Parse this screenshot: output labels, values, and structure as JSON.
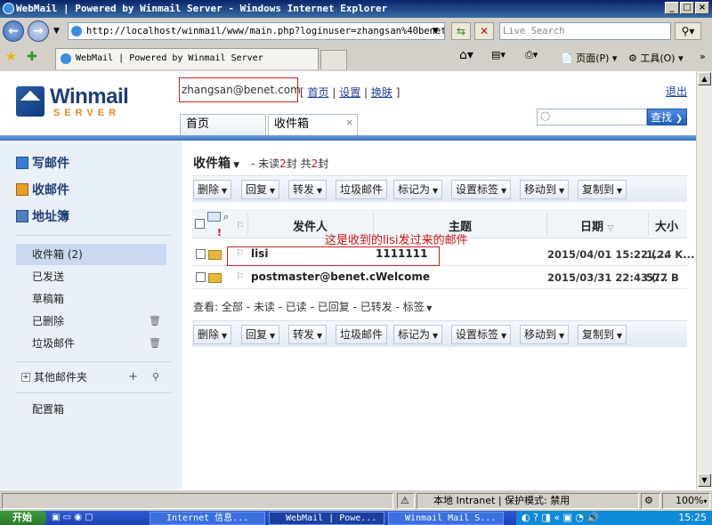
{
  "window": {
    "title": "WebMail | Powered by Winmail Server - Windows Internet Explorer"
  },
  "browser": {
    "url": "http://localhost/winmail/www/main.php?loginuser=zhangsan%40benet",
    "search_placeholder": "Live Search",
    "tab_label": "WebMail | Powered by Winmail Server",
    "page_menu": "页面(P)",
    "tools_menu": "工具(O)"
  },
  "header": {
    "logo_main": "Winmail",
    "logo_sub": "SERVER",
    "user": "zhangsan@benet.com",
    "links": {
      "home": "首页",
      "settings": "设置",
      "skin": "换肤"
    },
    "logout": "退出",
    "search_button": "查找",
    "tabs": [
      {
        "label": "首页"
      },
      {
        "label": "收件箱"
      }
    ]
  },
  "sidebar": {
    "compose": "写邮件",
    "receive": "收邮件",
    "contacts": "地址簿",
    "folders": [
      {
        "label": "收件箱 (2)"
      },
      {
        "label": "已发送"
      },
      {
        "label": "草稿箱"
      },
      {
        "label": "已删除"
      },
      {
        "label": "垃圾邮件"
      }
    ],
    "other_folders": "其他邮件夹",
    "config": "配置箱"
  },
  "main": {
    "folder_title": "收件箱",
    "unread_prefix": "- 未读",
    "unread_count": "2",
    "unread_unit": "封",
    "total_prefix": "共",
    "total_count": "2",
    "total_unit": "封",
    "toolbar": [
      "删除",
      "回复",
      "转发",
      "垃圾邮件",
      "标记为",
      "设置标签",
      "移动到",
      "复制到"
    ],
    "columns": {
      "sender": "发件人",
      "subject": "主题",
      "date": "日期",
      "size": "大小"
    },
    "messages": [
      {
        "sender": "lisi",
        "subject": "1111111",
        "date": "2015/04/01 15:22 (...",
        "size": "1.24 K..."
      },
      {
        "sender": "postmaster@benet.co...",
        "subject": "Welcome",
        "date": "2015/03/31 22:43 (...",
        "size": "577 B"
      }
    ],
    "annotation": "这是收到的lisi发过来的邮件",
    "view_filter": "查看: 全部 - 未读 - 已读 - 已回复 - 已转发 - 标签"
  },
  "statusbar": {
    "zone": "本地 Intranet | 保护模式: 禁用",
    "zoom": "100%"
  },
  "taskbar": {
    "start": "开始",
    "tasks": [
      "Internet 信息...",
      "WebMail | Powe...",
      "Winmail Mail S..."
    ],
    "clock": "15:25"
  }
}
